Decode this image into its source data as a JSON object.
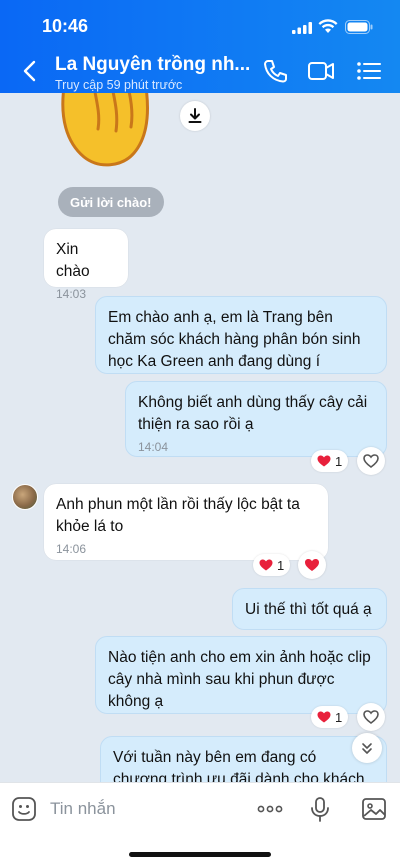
{
  "status_bar": {
    "time": "10:46"
  },
  "header": {
    "title": "La Nguyên trồng nh...",
    "subtitle": "Truy cập 59 phút trước",
    "icons": [
      "back-icon",
      "phone-icon",
      "video-call-icon",
      "menu-list-icon"
    ]
  },
  "chat": {
    "greet_chip": "Gửi lời chào!",
    "messages": [
      {
        "dir": "in",
        "text": "Xin chào",
        "time": "14:03"
      },
      {
        "dir": "out",
        "text": "Em chào anh ạ, em là Trang bên chăm sóc khách hàng phân bón sinh học Ka Green anh đang dùng í"
      },
      {
        "dir": "out",
        "text": "Không biết anh dùng thấy cây cải thiện ra sao rồi ạ",
        "time": "14:04",
        "reaction_count": "1"
      },
      {
        "dir": "in",
        "text": "Anh phun một lần rồi  thấy lộc bật ta khỏe  lá to",
        "time": "14:06",
        "reaction_count": "1"
      },
      {
        "dir": "out",
        "text": "Ui thế thì tốt quá ạ"
      },
      {
        "dir": "out",
        "text": "Nào tiện anh cho em xin ảnh hoặc clip cây nhà mình sau khi phun được không ạ",
        "reaction_count": "1"
      },
      {
        "dir": "out",
        "text": "Với tuần này bên em đang có chương trình ưu đãi dành cho khách quen em"
      }
    ]
  },
  "input_bar": {
    "placeholder": "Tin nhắn"
  },
  "colors": {
    "header_start": "#0a68f5",
    "header_end": "#1488f2",
    "out_bubble": "#d5ecfc",
    "heart": "#e8203b"
  }
}
